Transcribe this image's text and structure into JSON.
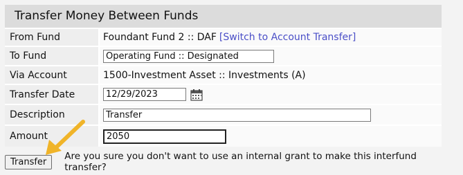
{
  "page": {
    "title": "Transfer Money Between Funds"
  },
  "form": {
    "from_fund": {
      "label": "From Fund",
      "value": "Foundant Fund 2 :: DAF",
      "link": "[Switch to Account Transfer]"
    },
    "to_fund": {
      "label": "To Fund",
      "value": "Operating Fund :: Designated"
    },
    "via_account": {
      "label": "Via Account",
      "value": "1500-Investment Asset :: Investments (A)"
    },
    "transfer_date": {
      "label": "Transfer Date",
      "value": "12/29/2023",
      "icon": "calendar-icon"
    },
    "description": {
      "label": "Description",
      "value": "Transfer"
    },
    "amount": {
      "label": "Amount",
      "value": "2050"
    }
  },
  "actions": {
    "transfer_label": "Transfer",
    "question": "Are you sure you don't want to use an internal grant to make this interfund transfer?"
  },
  "colors": {
    "link": "#4a4ec7",
    "arrow": "#f0b429",
    "header_bg": "#dcdcdc",
    "label_bg": "#eeeeee"
  }
}
